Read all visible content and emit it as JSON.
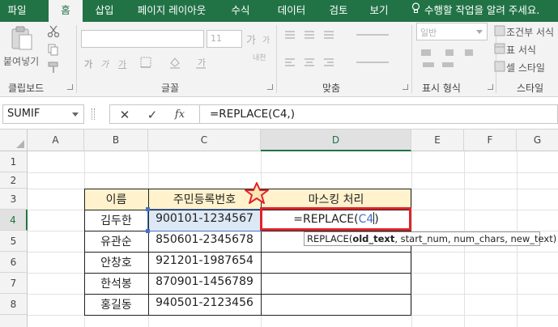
{
  "tabs": [
    {
      "label": "파일",
      "active": false
    },
    {
      "label": "홈",
      "active": true
    },
    {
      "label": "삽입",
      "active": false
    },
    {
      "label": "페이지 레이아웃",
      "active": false
    },
    {
      "label": "수식",
      "active": false
    },
    {
      "label": "데이터",
      "active": false
    },
    {
      "label": "검토",
      "active": false
    },
    {
      "label": "보기",
      "active": false
    }
  ],
  "tell_me": "수행할 작업을 알려 주세요.",
  "ribbon": {
    "clipboard": {
      "paste_label": "붙여넣기",
      "group_label": "클립보드"
    },
    "font": {
      "font_size": "11",
      "group_label": "글꼴",
      "grow_label": "가",
      "shrink_label": "가",
      "bold_label": "가",
      "italic_label": "가",
      "underline_label": "가",
      "phonetic_label": "내천"
    },
    "alignment": {
      "group_label": "맞춤"
    },
    "number": {
      "format": "일반",
      "group_label": "표시 형식"
    },
    "styles": {
      "conditional": "조건부 서식",
      "table": "표 서식",
      "cell": "셀 스타일",
      "group_label": "스타일"
    }
  },
  "formula_bar": {
    "name_box": "SUMIF",
    "cancel": "✕",
    "enter": "✓",
    "fx": "fx",
    "formula": "=REPLACE(C4,)"
  },
  "grid": {
    "columns": [
      "A",
      "B",
      "C",
      "D",
      "E",
      "F",
      "G"
    ],
    "rows": [
      "1",
      "2",
      "3",
      "4",
      "5",
      "6",
      "7",
      "8"
    ],
    "table_headers": {
      "name": "이름",
      "id": "주민등록번호",
      "masked": "마스킹 처리"
    },
    "table_rows": [
      {
        "name": "김두한",
        "id": "900101-1234567"
      },
      {
        "name": "유관순",
        "id": "850601-2345678"
      },
      {
        "name": "안창호",
        "id": "921201-1987654"
      },
      {
        "name": "한석봉",
        "id": "870901-1456789"
      },
      {
        "name": "홍길동",
        "id": "940501-2123456"
      }
    ],
    "editing_cell": {
      "prefix": "=REPLACE(",
      "ref": "C4",
      "suffix": ")"
    },
    "tooltip": {
      "func": "REPLACE(",
      "arg_bold": "old_text",
      "rest": ", start_num, num_chars, new_text)"
    }
  },
  "colors": {
    "accent": "#217346",
    "highlight": "#e0232b",
    "header_fill": "#fff2cc",
    "ref_blue": "#4472c4"
  }
}
